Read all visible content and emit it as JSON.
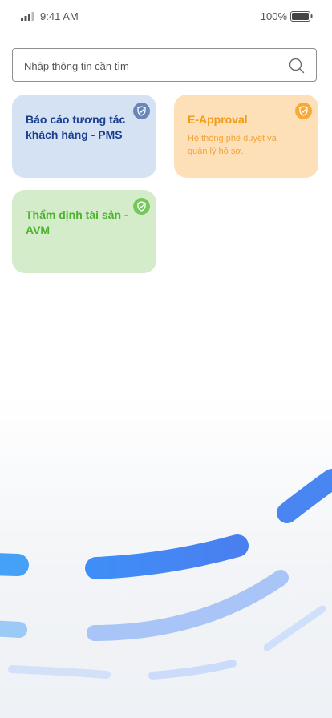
{
  "status_bar": {
    "time": "9:41 AM",
    "battery": "100%"
  },
  "search": {
    "placeholder": "Nhập thông tin cần tìm"
  },
  "cards": [
    {
      "title": "Báo cáo tương tác khách hàng - PMS",
      "description": ""
    },
    {
      "title": "E-Approval",
      "description": "Hệ thống phê duyệt và quản lý hồ sơ."
    },
    {
      "title": "Thẩm định tài sản - AVM",
      "description": ""
    }
  ],
  "colors": {
    "pms_bg": "#d5e2f4",
    "pms_text": "#1a3f8f",
    "eapproval_bg": "#fde0b8",
    "eapproval_text": "#f39a16",
    "avm_bg": "#d4ecc9",
    "avm_text": "#4cb22f",
    "decor_blue": "#3f8ef7"
  },
  "icons": [
    "signal-icon",
    "battery-icon",
    "search-icon",
    "shield-check-icon"
  ]
}
